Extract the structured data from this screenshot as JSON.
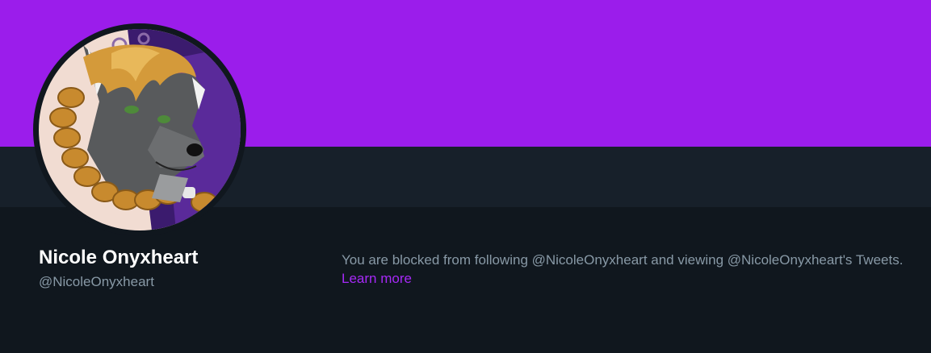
{
  "profile": {
    "display_name": "Nicole Onyxheart",
    "handle": "@NicoleOnyxheart",
    "avatar_description": "avatar-image"
  },
  "blocked_notice": {
    "message": "You are blocked from following @NicoleOnyxheart and viewing @NicoleOnyxheart's Tweets.",
    "learn_more_label": "Learn more"
  },
  "colors": {
    "banner": "#9b1deb",
    "nav_bar": "#17202a",
    "page_background": "#10171e",
    "link": "#a629f7",
    "muted_text": "#8899a6"
  }
}
